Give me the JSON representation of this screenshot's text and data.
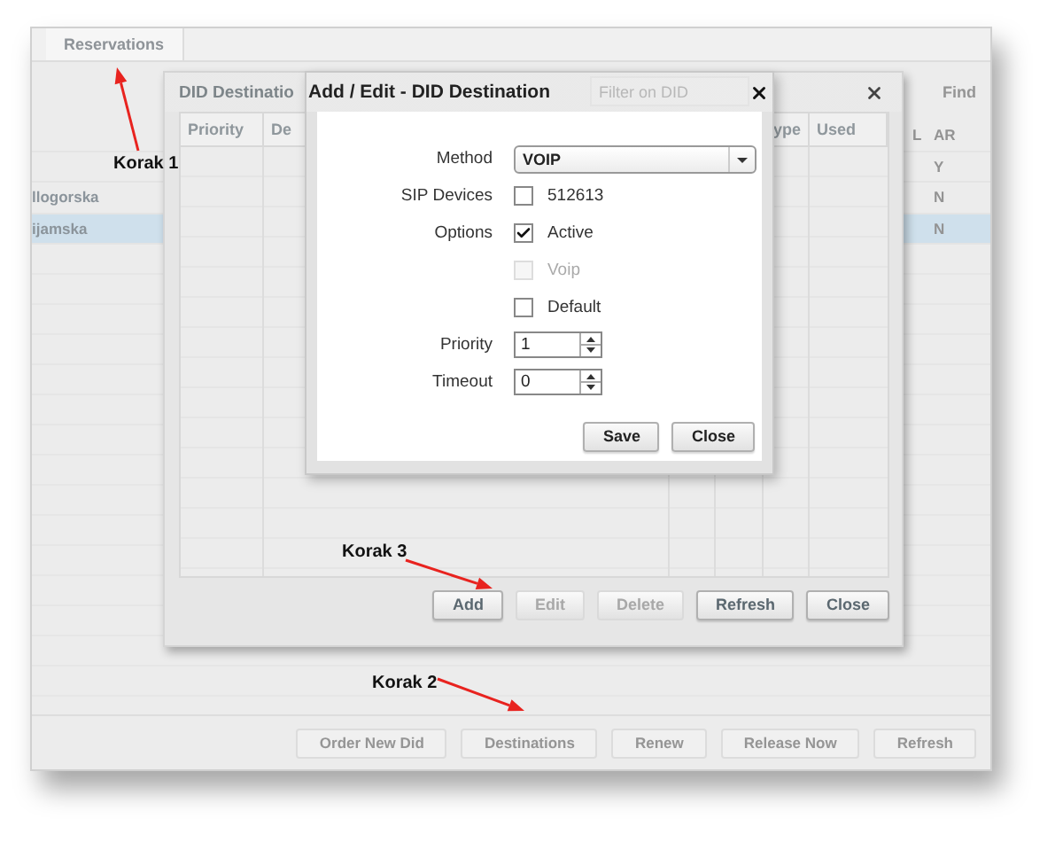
{
  "main_window": {
    "tabs": [
      {
        "label": "Reservations",
        "selected": true
      }
    ],
    "filter": {
      "placeholder": "Filter on DID"
    },
    "find_label": "Find",
    "columns": [
      "L",
      "AR"
    ],
    "rows": [
      {
        "ar": "Y",
        "selected": false
      },
      {
        "name": "llogorska",
        "ar": "N",
        "selected": false
      },
      {
        "name": "ijamska",
        "ar": "N",
        "selected": true
      }
    ],
    "buttons": [
      "Order New Did",
      "Destinations",
      "Renew",
      "Release Now",
      "Refresh"
    ]
  },
  "destinations_window": {
    "title": "DID Destinatio",
    "columns": [
      "Priority",
      "De",
      "ype",
      "Used"
    ],
    "buttons": [
      {
        "label": "Add",
        "disabled": false
      },
      {
        "label": "Edit",
        "disabled": true
      },
      {
        "label": "Delete",
        "disabled": true
      },
      {
        "label": "Refresh",
        "disabled": false
      },
      {
        "label": "Close",
        "disabled": false
      }
    ]
  },
  "dialog": {
    "title": "Add / Edit - DID Destination",
    "fields": [
      {
        "kind": "select",
        "label": "Method",
        "value": "VOIP"
      },
      {
        "kind": "checkbox",
        "label": "SIP Devices",
        "text": "512613",
        "checked": false,
        "disabled": false
      },
      {
        "kind": "checkbox",
        "label": "Options",
        "text": "Active",
        "checked": true,
        "disabled": false
      },
      {
        "kind": "checkbox",
        "text": "Voip",
        "checked": false,
        "disabled": true
      },
      {
        "kind": "checkbox",
        "text": "Default",
        "checked": false,
        "disabled": false
      },
      {
        "kind": "spinner",
        "label": "Priority",
        "value": "1"
      },
      {
        "kind": "spinner",
        "label": "Timeout",
        "value": "0"
      }
    ],
    "buttons": [
      "Save",
      "Close"
    ]
  },
  "annotations": [
    {
      "text": "Korak 1"
    },
    {
      "text": "Korak 3"
    },
    {
      "text": "Korak 2"
    }
  ]
}
